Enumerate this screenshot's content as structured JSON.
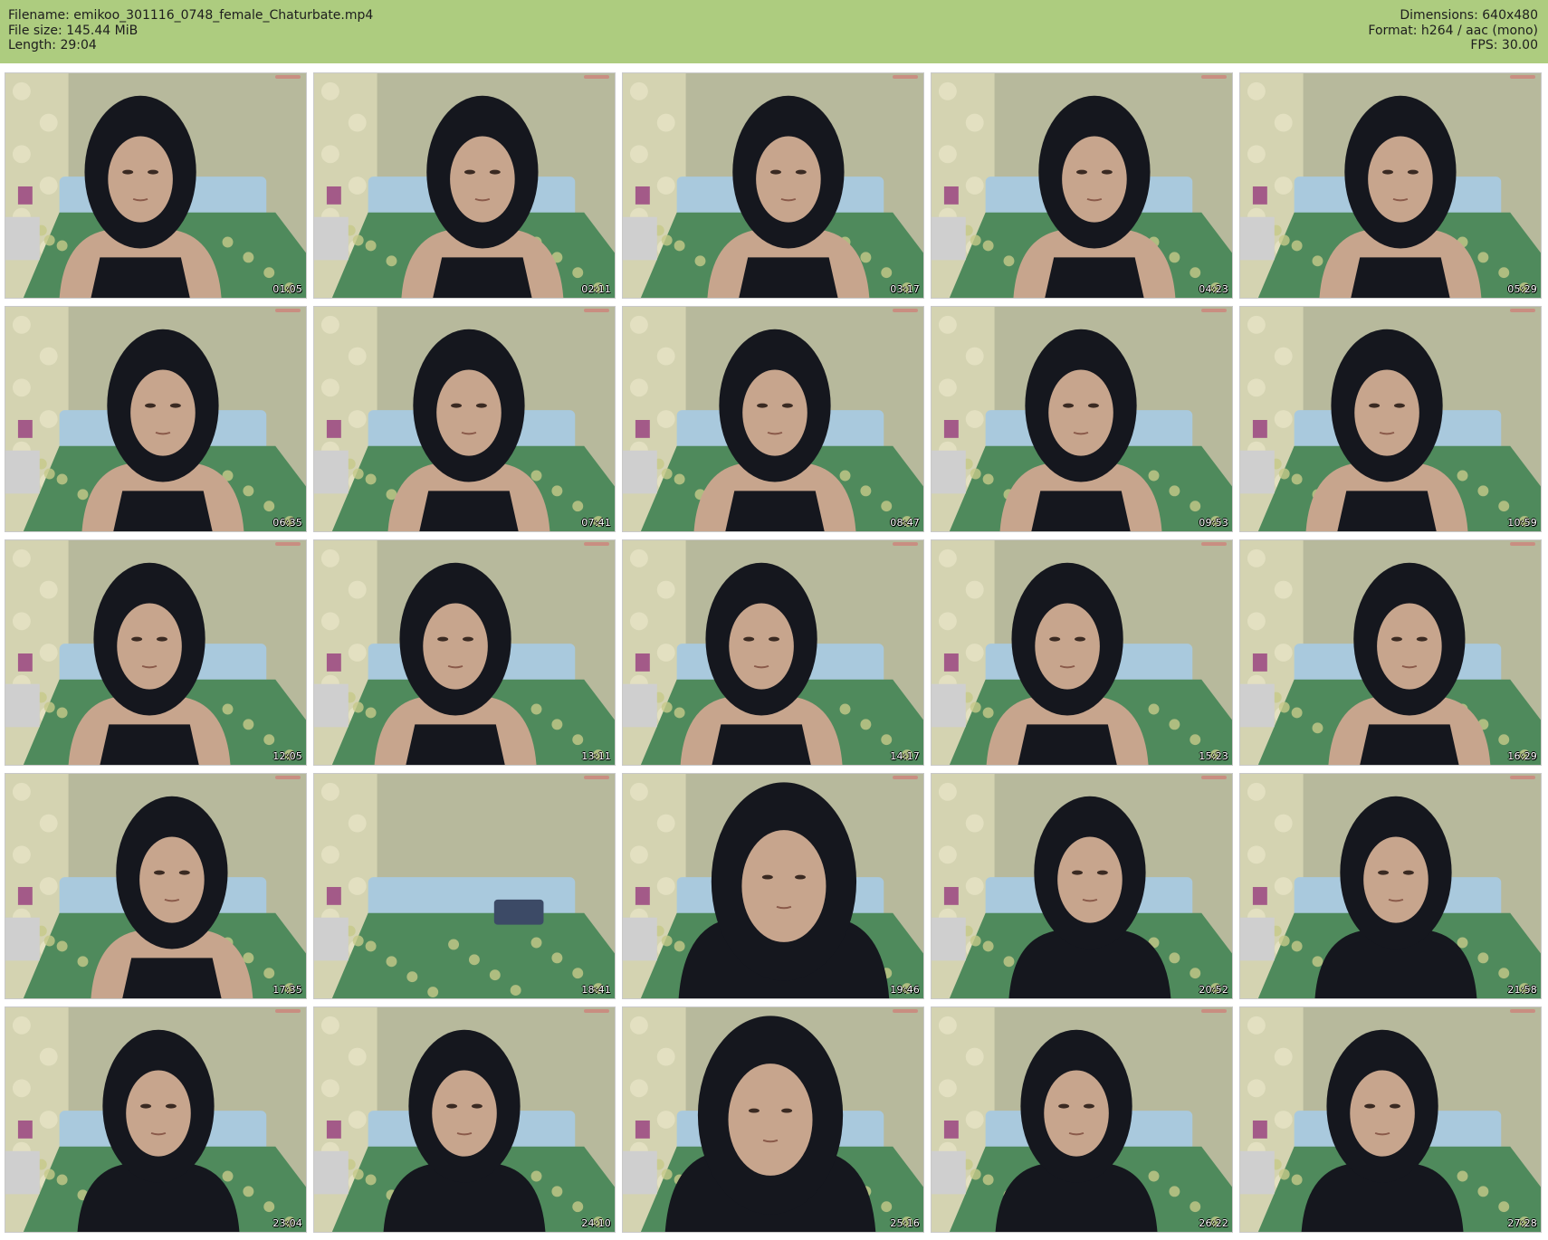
{
  "header": {
    "filename_line": "Filename: emikoo_301116_0748_female_Chaturbate.mp4",
    "filesize_line": "File size: 145.44 MiB",
    "length_line": "Length: 29:04",
    "dimensions_line": "Dimensions: 640x480",
    "format_line": "Format: h264 / aac (mono)",
    "fps_line": "FPS: 30.00"
  },
  "colors": {
    "header_bg": "#adcc7f",
    "wall": "#b7b99c",
    "headboard": "#a9c9dd",
    "bedspread": "#4f8a5c",
    "hair": "#15171e",
    "skin": "#c7a58d"
  },
  "thumbnails": [
    {
      "time": "01:05"
    },
    {
      "time": "02:11"
    },
    {
      "time": "03:17"
    },
    {
      "time": "04:23"
    },
    {
      "time": "05:29"
    },
    {
      "time": "06:35"
    },
    {
      "time": "07:41"
    },
    {
      "time": "08:47"
    },
    {
      "time": "09:53"
    },
    {
      "time": "10:59"
    },
    {
      "time": "12:05"
    },
    {
      "time": "13:11"
    },
    {
      "time": "14:17"
    },
    {
      "time": "15:23"
    },
    {
      "time": "16:29"
    },
    {
      "time": "17:35"
    },
    {
      "time": "18:41"
    },
    {
      "time": "19:46"
    },
    {
      "time": "20:52"
    },
    {
      "time": "21:58"
    },
    {
      "time": "23:04"
    },
    {
      "time": "24:10"
    },
    {
      "time": "25:16"
    },
    {
      "time": "26:22"
    },
    {
      "time": "27:28"
    }
  ]
}
